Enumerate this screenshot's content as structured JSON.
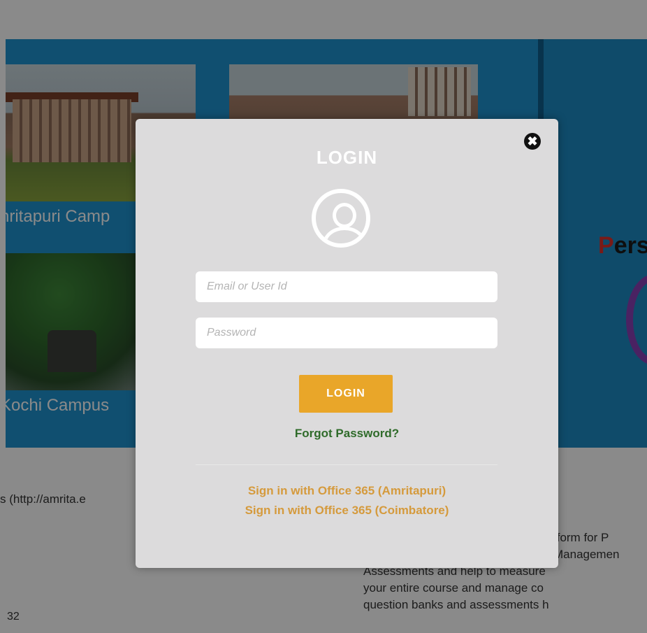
{
  "background": {
    "campuses": [
      {
        "label": "nritapuri Camp"
      },
      {
        "label": "Kochi  Campus"
      }
    ],
    "hero_title_first": "P",
    "hero_title_rest": "ers",
    "link_text": "s (http://amrita.e",
    "counter_text": "32",
    "description_lines": [
      "tform for P",
      "Managemen",
      "Assessments and help to measure",
      "your entire course and manage co",
      "question banks and assessments h"
    ]
  },
  "modal": {
    "close_icon": "✖",
    "title": "LOGIN",
    "email_placeholder": "Email or User Id",
    "password_placeholder": "Password",
    "login_button": "LOGIN",
    "forgot_password": "Forgot Password?",
    "office365_amritapuri": "Sign in with Office 365 (Amritapuri)",
    "office365_coimbatore": "Sign in with Office 365 (Coimbatore)"
  },
  "colors": {
    "accent_button": "#e9a629",
    "link_green": "#2f6b2a",
    "link_orange": "#d59a3c",
    "hero_blue": "#1f93cf"
  }
}
